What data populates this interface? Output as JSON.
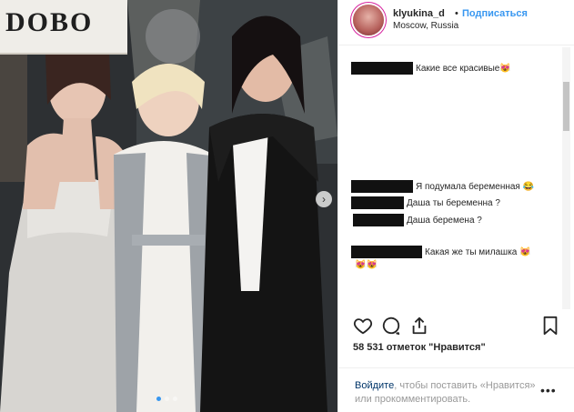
{
  "post": {
    "username": "klyukina_d",
    "separator": "•",
    "follow_label": "Подписаться",
    "location": "Moscow, Russia"
  },
  "photo": {
    "sign_text": "DOBO",
    "carousel_arrow": "›",
    "dots_count": 3,
    "active_dot": 0
  },
  "comments": [
    {
      "redact_width": 68,
      "text": "Какие все красивые😻"
    },
    {
      "redact_width": 68,
      "text": "Я подумала беременная 😂"
    },
    {
      "redact_width": 58,
      "text": "Даша ты беременна ?"
    },
    {
      "redact_width": 56,
      "text": "Даша беремена ?"
    },
    {
      "redact_width": 78,
      "text": "Какая же ты милашка 😻"
    },
    {
      "redact_width": 0,
      "text": "😻😻"
    }
  ],
  "likes": {
    "text": "58 531 отметок \"Нравится\""
  },
  "login": {
    "link_text": "Войдите",
    "rest_text": ", чтобы поставить «Нравится» или прокомментировать.",
    "more": "•••"
  },
  "icons": {
    "like": "heart-icon",
    "comment": "comment-icon",
    "share": "share-icon",
    "save": "bookmark-icon"
  }
}
